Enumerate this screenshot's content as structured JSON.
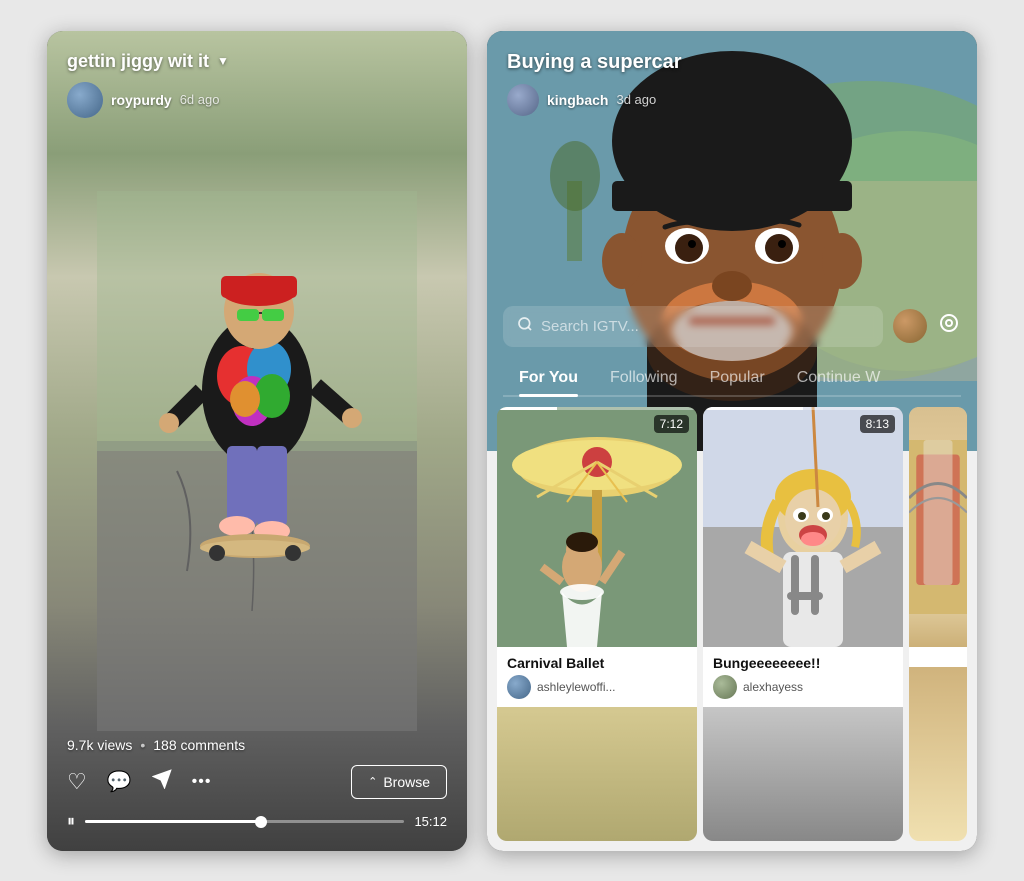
{
  "left": {
    "title": "gettin jiggy wit it",
    "username": "roypurdy",
    "time_ago": "6d ago",
    "views": "9.7k views",
    "comments": "188 comments",
    "duration": "15:12",
    "browse_label": "Browse",
    "progress_percent": 55
  },
  "right": {
    "title": "Buying a supercar",
    "username": "kingbach",
    "time_ago": "3d ago",
    "search_placeholder": "Search IGTV...",
    "tabs": [
      {
        "label": "For You",
        "active": true
      },
      {
        "label": "Following",
        "active": false
      },
      {
        "label": "Popular",
        "active": false
      },
      {
        "label": "Continue W",
        "active": false
      }
    ],
    "videos": [
      {
        "title": "Carnival Ballet",
        "username": "ashleylewoffi...",
        "duration": "7:12",
        "bg_colors": [
          "#7a9060",
          "#c8b870",
          "#d4cc88"
        ]
      },
      {
        "title": "Bungeeeeeeee!!",
        "username": "alexhayess",
        "duration": "8:13",
        "bg_colors": [
          "#b0b0b0",
          "#909090",
          "#c8c8c8"
        ]
      },
      {
        "title": "",
        "username": "",
        "duration": "",
        "bg_colors": [
          "#e8c890",
          "#d4a860",
          "#f0e0b0"
        ]
      }
    ]
  },
  "icons": {
    "heart": "♡",
    "comment": "💬",
    "share": "➤",
    "more": "•••",
    "play": "⏸",
    "search": "🔍",
    "settings": "◎",
    "dropdown": "▼",
    "browse_up": "⌃"
  }
}
